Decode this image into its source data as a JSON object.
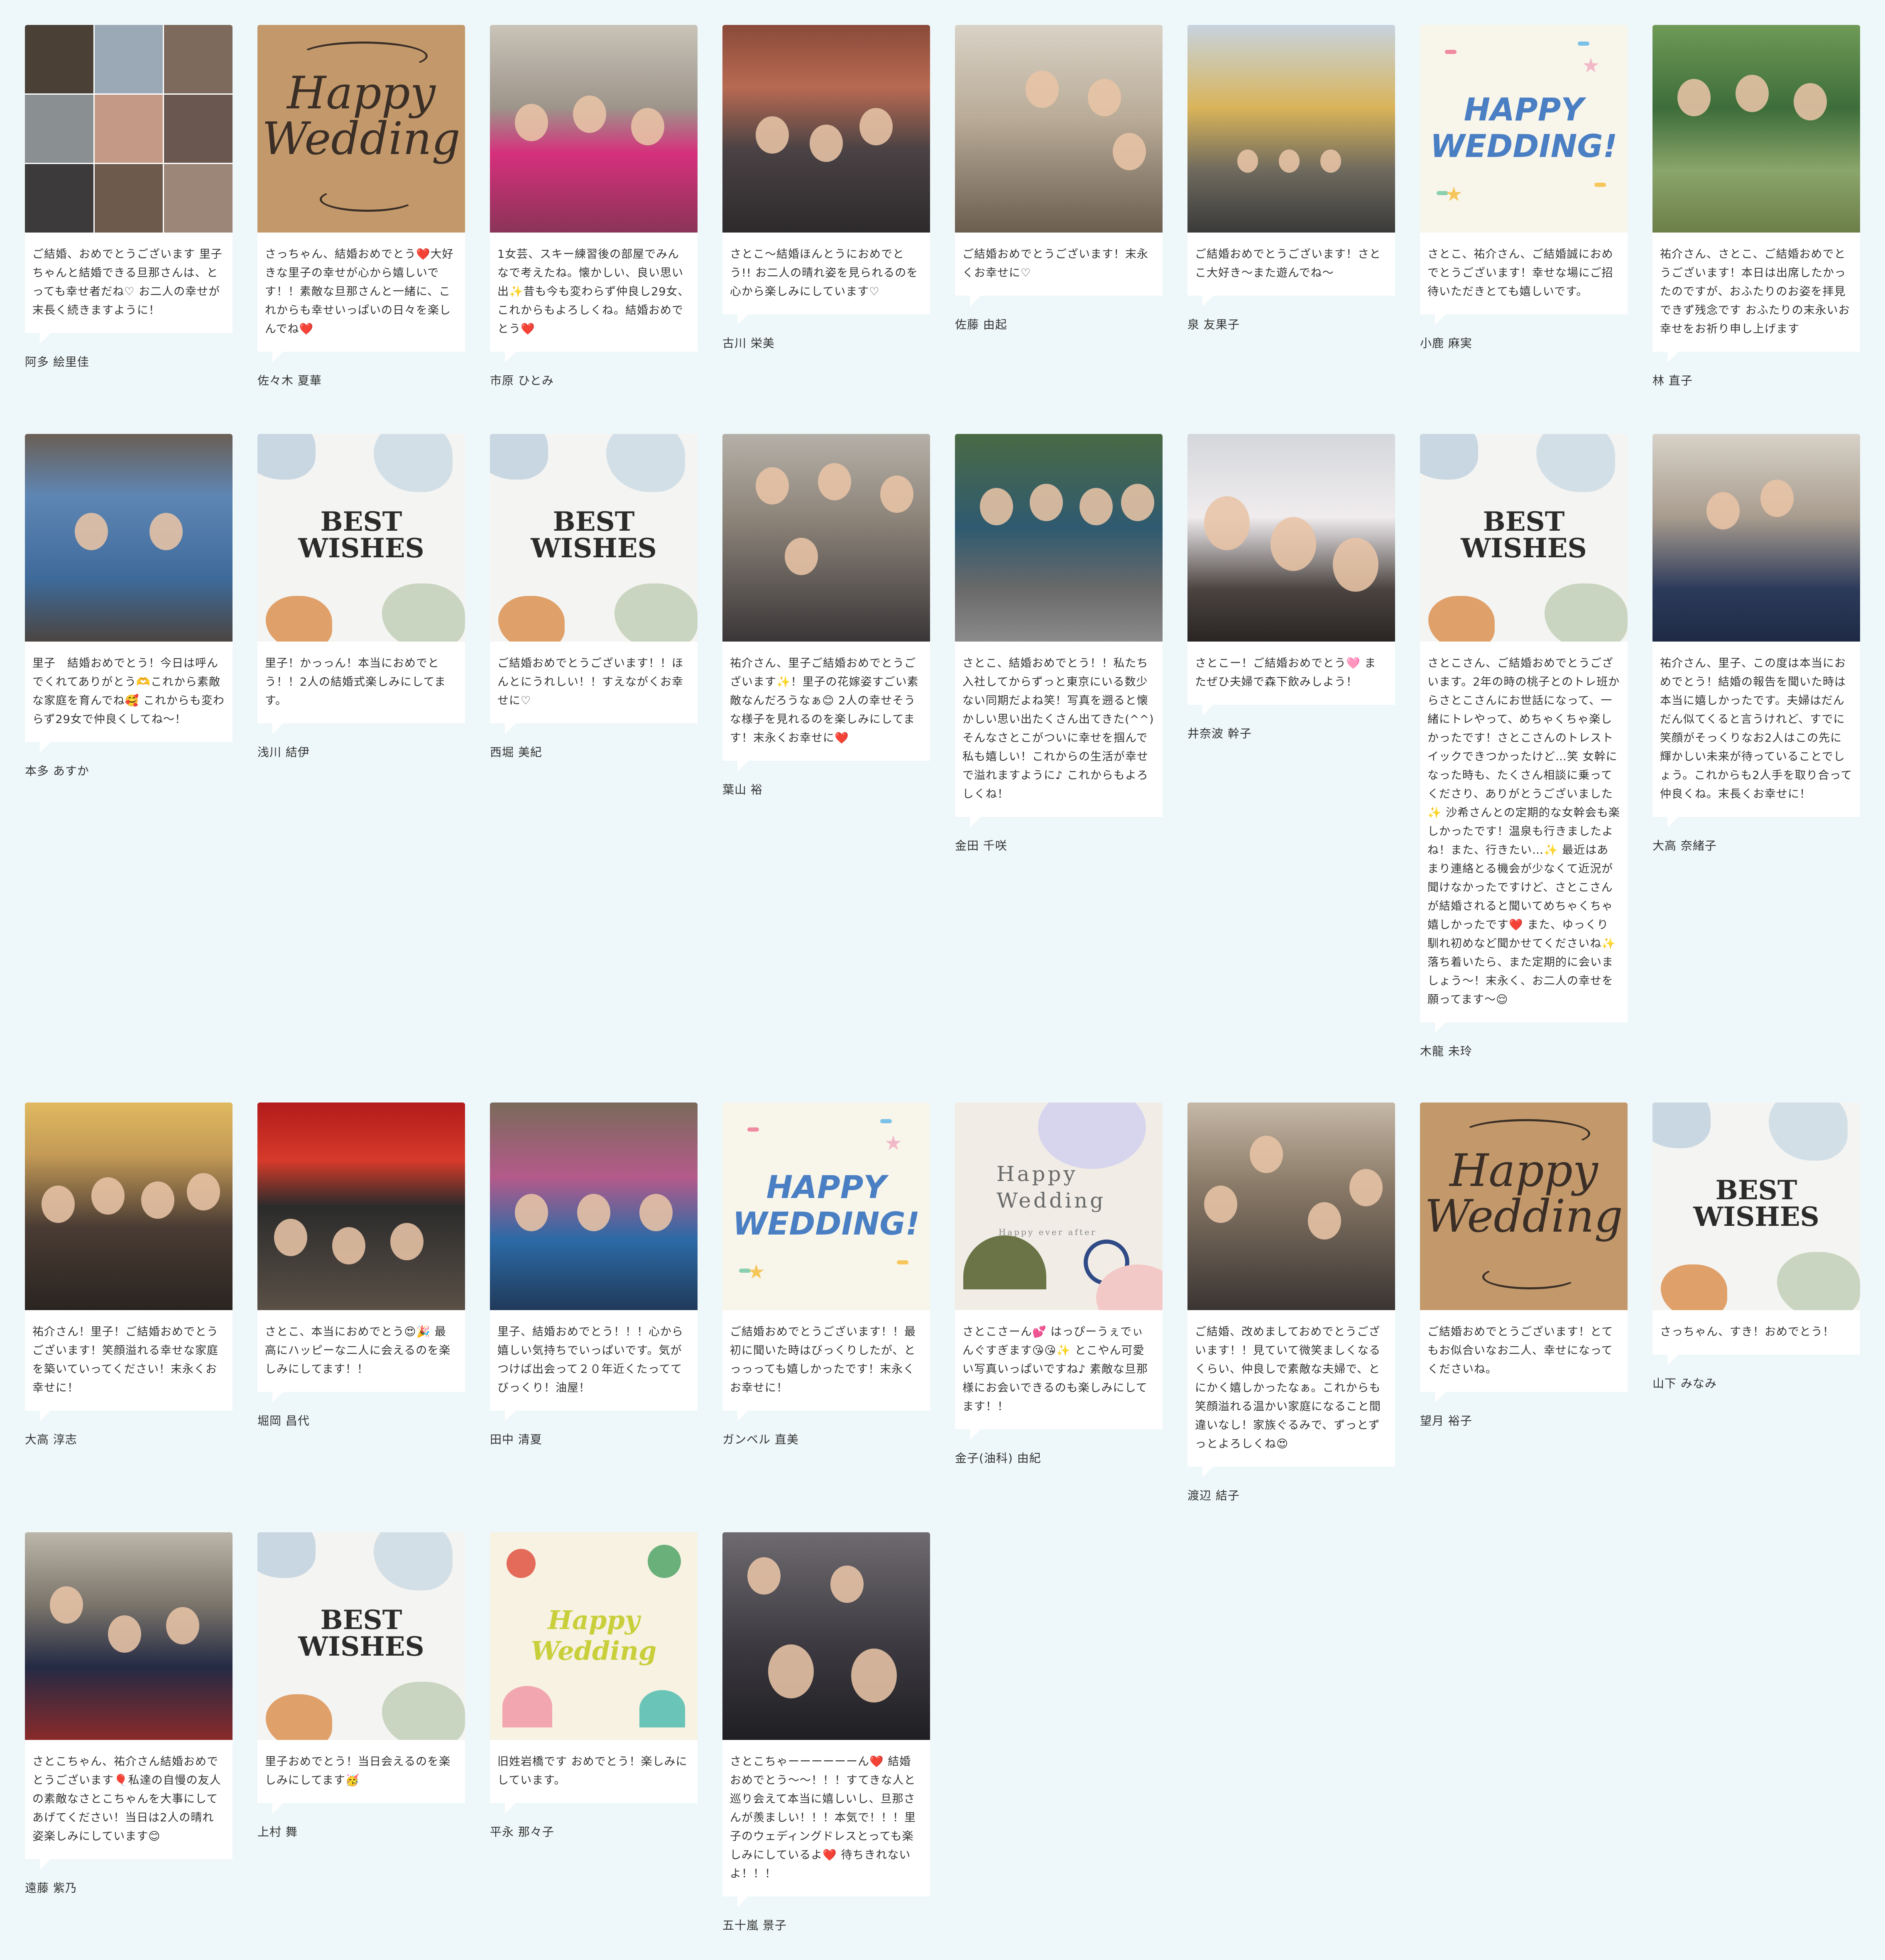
{
  "cards": [
    {
      "photo": "collage-photo",
      "message": "ご結婚、おめでとうございます 里子ちゃんと結婚できる旦那さんは、とっても幸せ者だね♡ お二人の幸せが末長く続きますように！",
      "author": "阿多 絵里佳"
    },
    {
      "template": "happy-wedding-kraft",
      "art_text": "Happy Wedding",
      "message": "さっちゃん、結婚おめでとう❤️大好きな里子の幸せが心から嬉しいです！！素敵な旦那さんと一緒に、これからも幸せいっぱいの日々を楽しんでね❤️",
      "author": "佐々木 夏華"
    },
    {
      "photo": "group-pink-shirts-photo",
      "message": "1女芸、スキー練習後の部屋でみんなで考えたね。懐かしい、良い思い出✨昔も今も変わらず仲良し29女、これからもよろしくね。結婚おめでとう❤️",
      "author": "市原 ひとみ"
    },
    {
      "photo": "group-outdoor-photo",
      "message": "さとこ〜結婚ほんとうにおめでとう!! お二人の晴れ姿を見られるのを心から楽しみにしています♡",
      "author": "古川 栄美"
    },
    {
      "photo": "group-dinner-photo",
      "message": "ご結婚おめでとうございます！末永くお幸せに♡",
      "author": "佐藤 由起"
    },
    {
      "photo": "group-campus-photo",
      "message": "ご結婚おめでとうございます！さとこ大好き〜また遊んでね〜",
      "author": "泉 友果子"
    },
    {
      "template": "happy-wedding-confetti",
      "art_text": "HAPPY WEDDING!",
      "message": "さとこ、祐介さん、ご結婚誠におめでとうございます！幸せな場にご招待いただきとても嬉しいです。",
      "author": "小鹿 麻実"
    },
    {
      "photo": "group-green-shirts-photo",
      "message": "祐介さん、さとこ、ご結婚おめでとうございます！本日は出席したかったのですが、おふたりのお姿を拝見できず残念です おふたりの末永いお幸せをお祈り申し上げます",
      "author": "林 直子"
    },
    {
      "photo": "seal-panel-photo",
      "message": "里子　結婚おめでとう！今日は呼んでくれてありがとう🫶これから素敵な家庭を育んでね🥰 これからも変わらず29女で仲良くしてね〜！",
      "author": "本多 あすか"
    },
    {
      "template": "best-wishes",
      "art_text": "BEST WISHES",
      "message": "里子！かっっん！本当におめでとう！！2人の結婚式楽しみにしてます。",
      "author": "浅川 結伊"
    },
    {
      "template": "best-wishes",
      "art_text": "BEST WISHES",
      "message": "ご結婚おめでとうございます！！ほんとにうれしい！！すえながくお幸せに♡",
      "author": "西堀 美紀"
    },
    {
      "photo": "group-baby-photo",
      "message": "祐介さん、里子ご結婚おめでとうございます✨！里子の花嫁姿すごい素敵なんだろうなぁ😊 2人の幸せそうな様子を見れるのを楽しみにしてます！末永くお幸せに❤️",
      "author": "葉山 裕"
    },
    {
      "photo": "group-park-photo",
      "message": "さとこ、結婚おめでとう！！私たち入社してからずっと東京にいる数少ない同期だよね笑！写真を遡ると懐かしい思い出たくさん出てきた(^^) そんなさとこがついに幸せを掴んで私も嬉しい！これからの生活が幸せで溢れますように♪ これからもよろしくね！",
      "author": "金田 千咲"
    },
    {
      "photo": "selfie-sakura-photo",
      "message": "さとこー！ご結婚おめでとう🩷 またぜひ夫婦で森下飲みしよう！",
      "author": "井奈波 幹子"
    },
    {
      "template": "best-wishes",
      "art_text": "BEST WISHES",
      "message": "さとこさん、ご結婚おめでとうございます。2年の時の桃子とのトレ班からさとこさんにお世話になって、一緒にトレやって、めちゃくちゃ楽しかったです！さとこさんのトレストイックできつかったけど…笑 女幹になった時も、たくさん相談に乗ってくださり、ありがとうございました✨ 沙希さんとの定期的な女幹会も楽しかったです！温泉も行きましたよね！また、行きたい…✨ 最近はあまり連絡とる機会が少なくて近況が聞けなかったですけど、さとこさんが結婚されると聞いてめちゃくちゃ嬉しかったです❤️ また、ゆっくり馴れ初めなど聞かせてくださいね✨落ち着いたら、また定期的に会いましょう～！末永く、お二人の幸せを願ってます～😌",
      "author": "木龍 未玲"
    },
    {
      "photo": "hug-photo",
      "message": "祐介さん、里子、この度は本当におめでとう！結婚の報告を聞いた時は本当に嬉しかったです。夫婦はだんだん似てくると言うけれど、すでに笑顔がそっくりなお2人はこの先に輝かしい未来が待っていることでしょう。これからも2人手を取り合って仲良くね。末長くお幸せに！",
      "author": "大高 奈緒子"
    },
    {
      "photo": "group-party-photo",
      "message": "祐介さん！里子！ご結婚おめでとうございます！笑顔溢れる幸せな家庭を築いていってください！末永くお幸せに！",
      "author": "大高 淳志"
    },
    {
      "photo": "night-sign-photo",
      "message": "さとこ、本当におめでとう😍🎉 最高にハッピーな二人に会えるのを楽しみにしてます！！",
      "author": "堀岡 昌代"
    },
    {
      "photo": "knit-hats-photo",
      "message": "里子、結婚おめでとう！！！心から嬉しい気持ちでいっぱいです。気がつけば出会って２０年近くたっててびっくり！油屋！",
      "author": "田中 清夏"
    },
    {
      "template": "happy-wedding-confetti",
      "art_text": "HAPPY WEDDING!",
      "message": "ご結婚おめでとうございます！！最初に聞いた時はびっくりしたが、とっっっても嬉しかったです！末永くお幸せに！",
      "author": "ガンベル 直美"
    },
    {
      "template": "happy-wedding-pastel",
      "art_text": "Happy Wedding",
      "art_sub": "Happy ever after",
      "message": "さとこさーん💕 はっぴーうぇでぃんぐすぎます😘😘✨ とこやん可愛い写真いっぱいですね♪ 素敵な旦那様にお会いできるのも楽しみにしてます！！",
      "author": "金子(油科) 由紀"
    },
    {
      "photo": "family-home-photo",
      "message": "ご結婚、改めましておめでとうございます！！見ていて微笑ましくなるくらい、仲良しで素敵な夫婦で、とにかく嬉しかったなぁ。これからも笑顔溢れる温かい家庭になること間違いなし！家族ぐるみで、ずっとずっとよろしくね😍",
      "author": "渡辺 結子"
    },
    {
      "template": "happy-wedding-kraft",
      "art_text": "Happy Wedding",
      "message": "ご結婚おめでとうございます！とてもお似合いなお二人、幸せになってくださいね。",
      "author": "望月 裕子"
    },
    {
      "template": "best-wishes",
      "art_text": "BEST WISHES",
      "message": "さっちゃん、すき！おめでとう！",
      "author": "山下 みなみ"
    },
    {
      "photo": "uniform-escalator-photo",
      "message": "さとこちゃん、祐介さん結婚おめでとうございます🎈私達の自慢の友人の素敵なさとこちゃんを大事にしてあげてください！当日は2人の晴れ姿楽しみにしています😊",
      "author": "遠藤 紫乃"
    },
    {
      "template": "best-wishes",
      "art_text": "BEST WISHES",
      "message": "里子おめでとう！当日会えるのを楽しみにしてます🥳",
      "author": "上村 舞"
    },
    {
      "template": "happy-wedding-yoga",
      "art_text": "Happy Wedding",
      "message": "旧姓岩橋です おめでとう！楽しみにしています。",
      "author": "平永 那々子"
    },
    {
      "photo": "uniform-selfie-photo",
      "message": "さとこちゃーーーーーーん❤️ 結婚おめでとう〜〜！！！すてきな人と巡り会えて本当に嬉しいし、旦那さんが羨ましい！！！本気で！！！里子のウェディングドレスとっても楽しみにしているよ❤️ 待ちきれないよ！！！",
      "author": "五十嵐 景子"
    }
  ],
  "colors": {
    "background": "#eef7f9",
    "card": "#ffffff",
    "text": "#333333"
  }
}
